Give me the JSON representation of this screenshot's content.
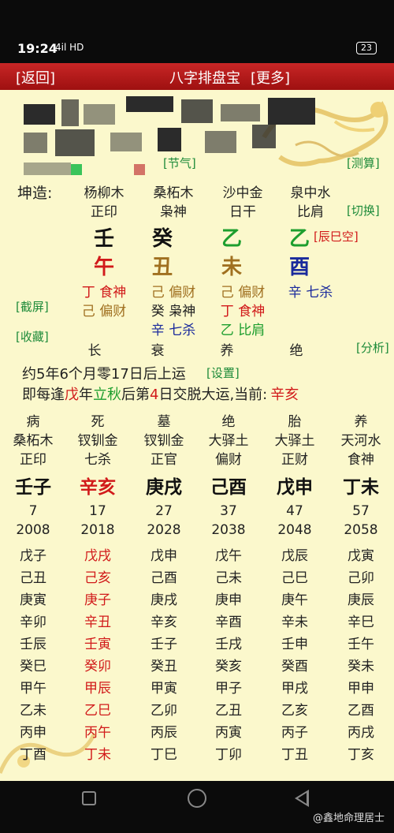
{
  "status": {
    "time": "19:24",
    "signal": "4il HD",
    "battery": "23"
  },
  "titlebar": {
    "back": "[返回]",
    "title": "八字排盘宝",
    "more": "[更多]"
  },
  "links": {
    "jieqi": "[节气]",
    "cesuan": "[测算]",
    "qiehuan": "[切换]",
    "jieping": "[截屏]",
    "shoucang": "[收藏]",
    "fenxi": "[分析]",
    "shezhi": "[设置]"
  },
  "gender_label": "坤造:",
  "pillars": [
    {
      "nayin": "杨柳木",
      "god": "正印",
      "stem": "壬",
      "branch": "午",
      "hidden": [
        {
          "text": "丁 食神",
          "color": "#d11a1a"
        },
        {
          "text": "己 偏财",
          "color": "#a07020"
        }
      ],
      "stage": "长"
    },
    {
      "nayin": "桑柘木",
      "god": "枭神",
      "stem": "癸",
      "branch": "丑",
      "hidden": [
        {
          "text": "己 偏财",
          "color": "#a07020"
        },
        {
          "text": "癸 枭神",
          "color": "#222"
        },
        {
          "text": "辛 七杀",
          "color": "#1a2a9c"
        }
      ],
      "stage": "衰"
    },
    {
      "nayin": "沙中金",
      "god": "日干",
      "stem": "乙",
      "branch": "未",
      "hidden": [
        {
          "text": "己 偏财",
          "color": "#a07020"
        },
        {
          "text": "丁 食神",
          "color": "#d11a1a"
        },
        {
          "text": "乙 比肩",
          "color": "#1d9e2e"
        }
      ],
      "stage": "养"
    },
    {
      "nayin": "泉中水",
      "god": "比肩",
      "stem": "乙",
      "branch": "酉",
      "hidden": [
        {
          "text": "辛 七杀",
          "color": "#1a2a9c"
        }
      ],
      "stage": "绝"
    }
  ],
  "kongwang": "[辰巳空]",
  "yun1": "约5年6个月零17日后上运",
  "yun2": {
    "a": "即每逢",
    "b": "戊",
    "c": "年",
    "d": "立秋",
    "e": "后第",
    "f": "4",
    "g": "日交脱大运,当前:",
    "h": "辛亥"
  },
  "dayun": [
    {
      "stage": "病",
      "nayin": "桑柘木",
      "god": "正印",
      "gz": "壬子",
      "age": "7",
      "year": "2008",
      "years": [
        "戊子",
        "己丑",
        "庚寅",
        "辛卯",
        "壬辰",
        "癸巳",
        "甲午",
        "乙未",
        "丙申",
        "丁酉"
      ],
      "current": false
    },
    {
      "stage": "死",
      "nayin": "钗钏金",
      "god": "七杀",
      "gz": "辛亥",
      "age": "17",
      "year": "2018",
      "years": [
        "戊戌",
        "己亥",
        "庚子",
        "辛丑",
        "壬寅",
        "癸卯",
        "甲辰",
        "乙巳",
        "丙午",
        "丁未"
      ],
      "current": true
    },
    {
      "stage": "墓",
      "nayin": "钗钏金",
      "god": "正官",
      "gz": "庚戌",
      "age": "27",
      "year": "2028",
      "years": [
        "戊申",
        "己酉",
        "庚戌",
        "辛亥",
        "壬子",
        "癸丑",
        "甲寅",
        "乙卯",
        "丙辰",
        "丁巳"
      ],
      "current": false
    },
    {
      "stage": "绝",
      "nayin": "大驿土",
      "god": "偏财",
      "gz": "己酉",
      "age": "37",
      "year": "2038",
      "years": [
        "戊午",
        "己未",
        "庚申",
        "辛酉",
        "壬戌",
        "癸亥",
        "甲子",
        "乙丑",
        "丙寅",
        "丁卯"
      ],
      "current": false
    },
    {
      "stage": "胎",
      "nayin": "大驿土",
      "god": "正财",
      "gz": "戊申",
      "age": "47",
      "year": "2048",
      "years": [
        "戊辰",
        "己巳",
        "庚午",
        "辛未",
        "壬申",
        "癸酉",
        "甲戌",
        "乙亥",
        "丙子",
        "丁丑"
      ],
      "current": false
    },
    {
      "stage": "养",
      "nayin": "天河水",
      "god": "食神",
      "gz": "丁未",
      "age": "57",
      "year": "2058",
      "years": [
        "戊寅",
        "己卯",
        "庚辰",
        "辛巳",
        "壬午",
        "癸未",
        "甲申",
        "乙酉",
        "丙戌",
        "丁亥"
      ],
      "current": false
    }
  ],
  "watermark": "@鑫地命理居士"
}
